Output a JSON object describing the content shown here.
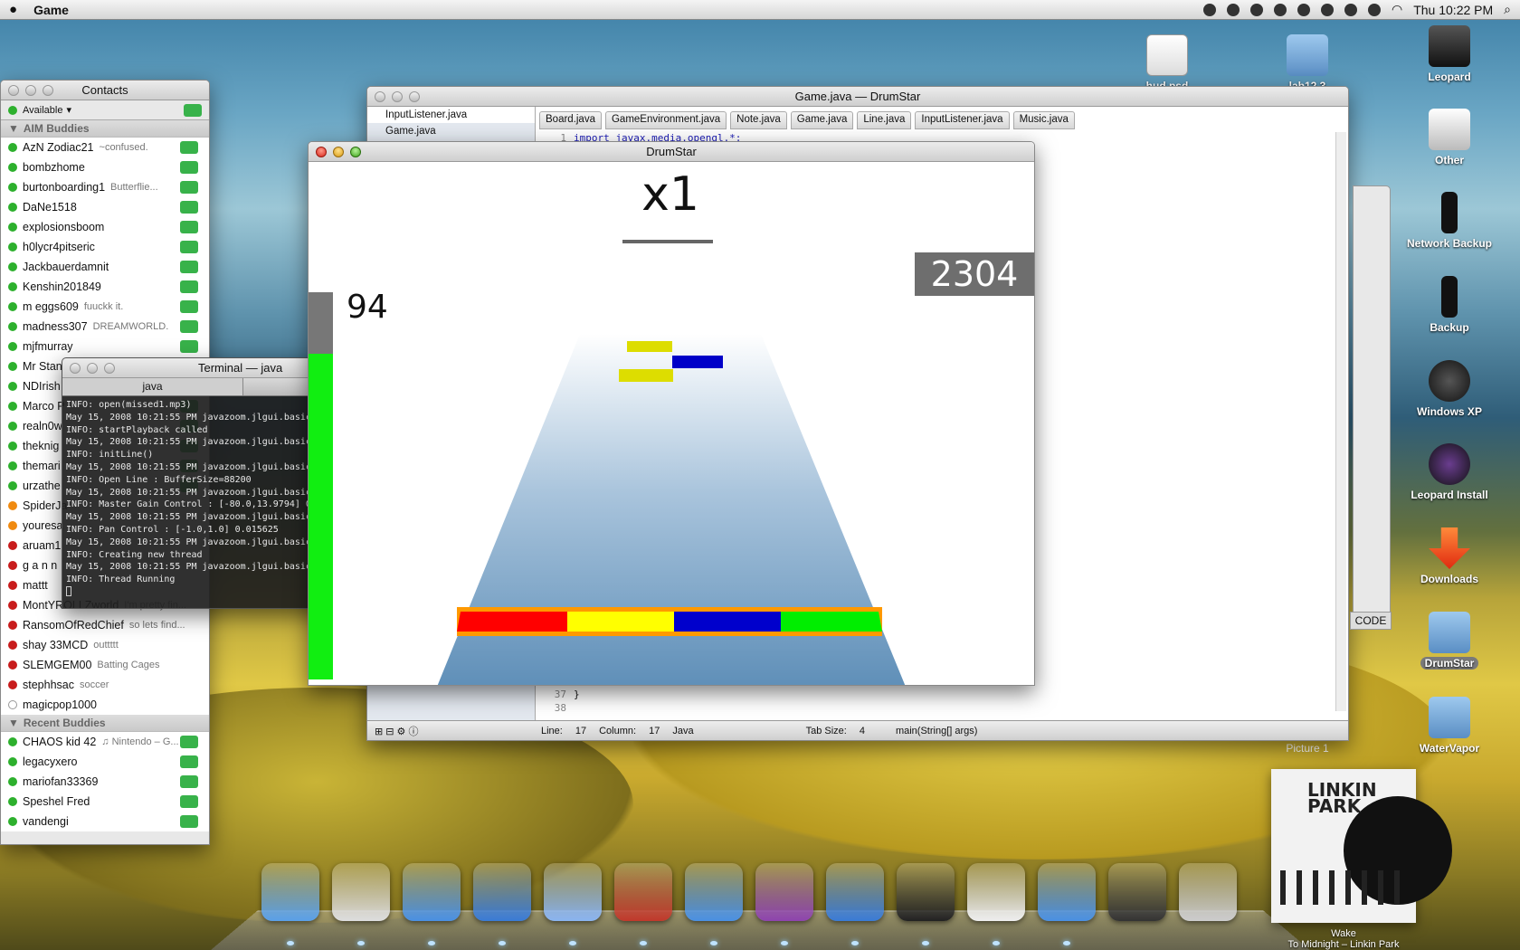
{
  "menubar": {
    "app_name": "Game",
    "clock": "Thu 10:22 PM"
  },
  "desktop_icons": [
    {
      "label": "hud.psd",
      "icon": "image-file-icon"
    },
    {
      "label": "lab12.3",
      "icon": "folder-icon"
    },
    {
      "label": "Leopard",
      "icon": "hard-drive-icon"
    },
    {
      "label": "Other",
      "icon": "external-drive-icon"
    },
    {
      "label": "Network Backup",
      "icon": "backup-drive-icon"
    },
    {
      "label": "Backup",
      "icon": "backup-drive-icon"
    },
    {
      "label": "Windows XP",
      "icon": "windows-icon"
    },
    {
      "label": "Leopard Install",
      "icon": "install-disc-icon"
    },
    {
      "label": "Downloads",
      "icon": "downloads-icon"
    },
    {
      "label": "DrumStar",
      "icon": "folder-icon"
    },
    {
      "label": "WaterVapor",
      "icon": "folder-icon"
    },
    {
      "label": "Picture 1",
      "icon": "image-file-icon"
    }
  ],
  "contacts": {
    "title": "Contacts",
    "status": "Available",
    "groups": [
      {
        "name": "AIM Buddies",
        "buddies": [
          {
            "name": "AzN Zodiac21",
            "msg": "~confused.",
            "state": "green"
          },
          {
            "name": "bombzhome",
            "msg": "",
            "state": "green"
          },
          {
            "name": "burtonboarding1",
            "msg": "Butterflie...",
            "state": "green"
          },
          {
            "name": "DaNe1518",
            "msg": "",
            "state": "green"
          },
          {
            "name": "explosionsboom",
            "msg": "",
            "state": "green"
          },
          {
            "name": "h0lycr4pitseric",
            "msg": "",
            "state": "green"
          },
          {
            "name": "Jackbauerdamnit",
            "msg": "",
            "state": "green"
          },
          {
            "name": "Kenshin201849",
            "msg": "",
            "state": "green"
          },
          {
            "name": "m eggs609",
            "msg": "fuuckk it.",
            "state": "green"
          },
          {
            "name": "madness307",
            "msg": "DREAMWORLD.",
            "state": "green"
          },
          {
            "name": "mjfmurray",
            "msg": "",
            "state": "green"
          },
          {
            "name": "Mr Stan",
            "msg": "",
            "state": "green"
          },
          {
            "name": "NDIrish",
            "msg": "",
            "state": "green"
          },
          {
            "name": "Marco P",
            "msg": "",
            "state": "green"
          },
          {
            "name": "realn0w",
            "msg": "",
            "state": "green"
          },
          {
            "name": "theknig",
            "msg": "",
            "state": "green"
          },
          {
            "name": "themari",
            "msg": "",
            "state": "green"
          },
          {
            "name": "urzathe",
            "msg": "",
            "state": "green"
          },
          {
            "name": "SpiderJa",
            "msg": "",
            "state": "orange"
          },
          {
            "name": "youresa",
            "msg": "",
            "state": "orange"
          },
          {
            "name": "aruam1",
            "msg": "",
            "state": "red"
          },
          {
            "name": "g a n n",
            "msg": "",
            "state": "red"
          },
          {
            "name": "mattt",
            "msg": "",
            "state": "red"
          },
          {
            "name": "MontYROLLZworld",
            "msg": "I'm pretty fin...",
            "state": "red"
          },
          {
            "name": "RansomOfRedChief",
            "msg": "so lets find...",
            "state": "red"
          },
          {
            "name": "shay    33MCD",
            "msg": "outtttt",
            "state": "red"
          },
          {
            "name": "SLEMGEM00",
            "msg": "Batting Cages",
            "state": "red"
          },
          {
            "name": "stephhsac",
            "msg": "soccer",
            "state": "red"
          },
          {
            "name": "magicpop1000",
            "msg": "",
            "state": "none"
          }
        ]
      },
      {
        "name": "Recent Buddies",
        "buddies": [
          {
            "name": "CHAOS kid 42",
            "msg": "♫ Nintendo – G...",
            "state": "green"
          },
          {
            "name": "legacyxero",
            "msg": "",
            "state": "green"
          },
          {
            "name": "mariofan33369",
            "msg": "",
            "state": "green"
          },
          {
            "name": "Speshel Fred",
            "msg": "",
            "state": "green"
          },
          {
            "name": "vandengi",
            "msg": "",
            "state": "green"
          }
        ]
      }
    ]
  },
  "xcode": {
    "title": "Game.java — DrumStar",
    "files": [
      "InputListener.java",
      "Game.java"
    ],
    "tabs": [
      "Board.java",
      "GameEnvironment.java",
      "Note.java",
      "Game.java",
      "Line.java",
      "InputListener.java",
      "Music.java"
    ],
    "first_line_num": "1",
    "first_line_code": "import javax.media.opengl.*;",
    "last_line_num": "37",
    "last_line_code": "}",
    "overflow_line_num": "38",
    "status": {
      "line_label": "Line:",
      "line": "17",
      "col_label": "Column:",
      "col": "17",
      "lang": "Java",
      "tab_label": "Tab Size:",
      "tab": "4",
      "method": "main(String[] args)"
    }
  },
  "terminal": {
    "title": "Terminal — java",
    "tab": "java",
    "lines": [
      "INFO: open(missed1.mp3)",
      "May 15, 2008 10:21:55 PM javazoom.jlgui.basic",
      "INFO: startPlayback called",
      "May 15, 2008 10:21:55 PM javazoom.jlgui.basic",
      "INFO: initLine()",
      "May 15, 2008 10:21:55 PM javazoom.jlgui.basic",
      "INFO: Open Line : BufferSize=88200",
      "May 15, 2008 10:21:55 PM javazoom.jlgui.basic",
      "INFO: Master Gain Control : [-80.0,13.9794] 0",
      "May 15, 2008 10:21:55 PM javazoom.jlgui.basic",
      "INFO: Pan Control : [-1.0,1.0] 0.015625",
      "May 15, 2008 10:21:55 PM javazoom.jlgui.basic",
      "INFO: Creating new thread",
      "May 15, 2008 10:21:55 PM javazoom.jlgui.basic",
      "INFO: Thread Running"
    ]
  },
  "game": {
    "title": "DrumStar",
    "multiplier": "x1",
    "score": "2304",
    "combo": "94",
    "health_fraction": 0.84,
    "lanes": [
      "#ff0000",
      "#ffff00",
      "#0000cc",
      "#00ee00"
    ]
  },
  "drawer": {
    "code_label": "CODE"
  },
  "album": {
    "band": "LINKIN PARK",
    "caption_line1": "Wake",
    "caption_line2": "To Midnight – Linkin Park"
  },
  "dock": {
    "apps": [
      "finder-icon",
      "headphones-icon",
      "ichat-icon",
      "safari-icon",
      "clock-icon",
      "utility-icon",
      "word-icon",
      "preferences-icon",
      "feather-icon",
      "terminal-icon",
      "coffee-icon",
      "applications-folder-icon",
      "screen-icon",
      "trash-icon"
    ]
  }
}
